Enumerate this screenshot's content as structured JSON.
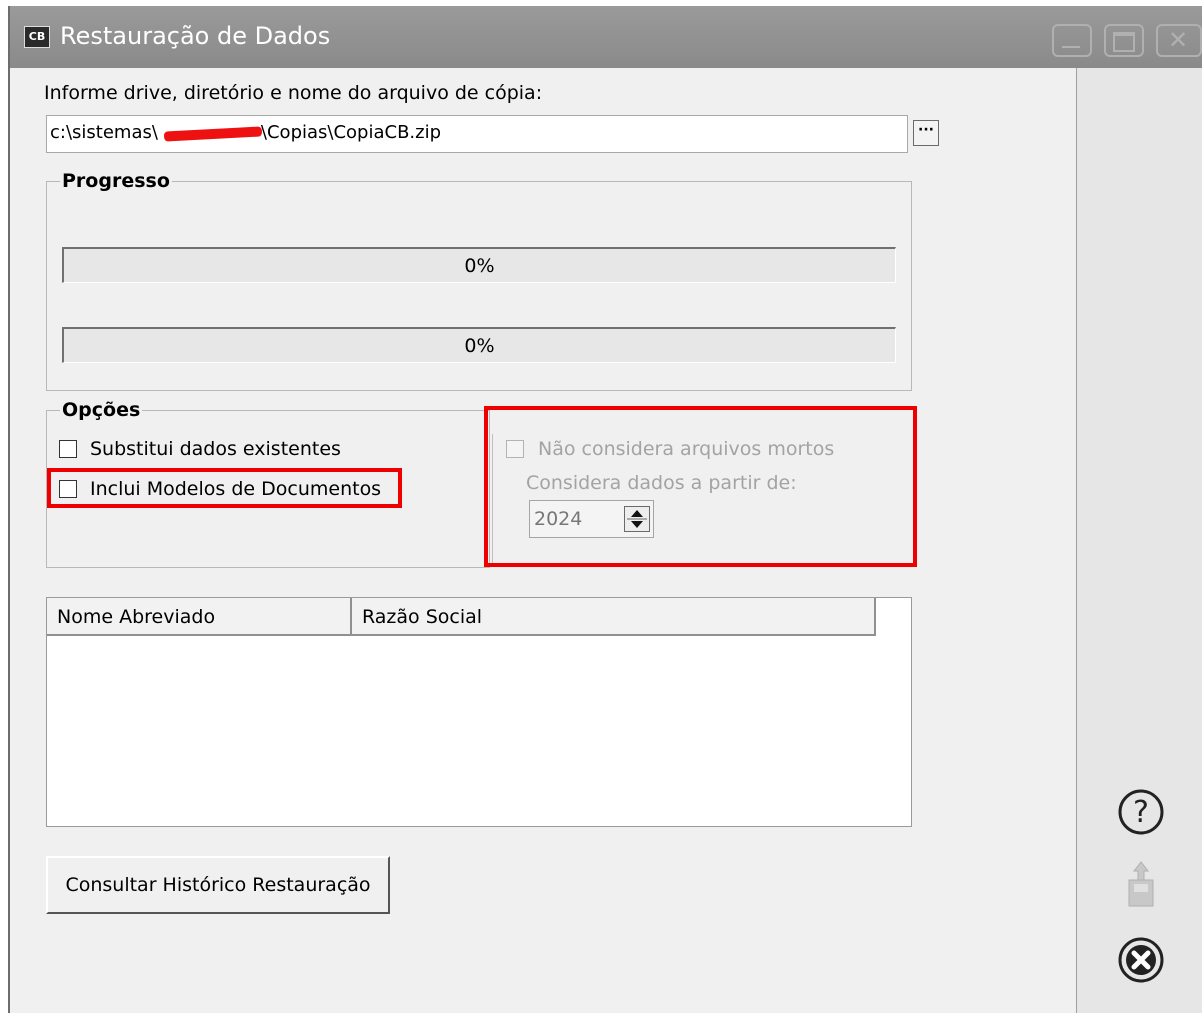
{
  "window": {
    "app_icon": "CB",
    "title": "Restauração de Dados",
    "caption_buttons": [
      "minimize-icon",
      "maximize-icon",
      "close-icon"
    ]
  },
  "path_section": {
    "label": "Informe drive, diretório e nome do arquivo de cópia:",
    "value_prefix": "c:\\sistemas\\",
    "value_suffix": "\\Copias\\CopiaCB.zip",
    "browse_label": "···"
  },
  "progress": {
    "title": "Progresso",
    "bars": [
      {
        "percent": 0,
        "label": "0%"
      },
      {
        "percent": 0,
        "label": "0%"
      }
    ]
  },
  "options": {
    "title": "Opções",
    "substitui_label": "Substitui dados existentes",
    "substitui_checked": false,
    "modelos_label": "Inclui Modelos de Documentos",
    "modelos_checked": false,
    "arquivos_mortos_label": "Não considera arquivos mortos",
    "arquivos_mortos_checked": false,
    "arquivos_mortos_enabled": false,
    "considera_label": "Considera dados a partir de:",
    "year_value": "2024"
  },
  "table": {
    "columns": [
      "Nome Abreviado",
      "Razão Social"
    ],
    "rows": []
  },
  "buttons": {
    "historico_label": "Consultar Histórico Restauração"
  },
  "side_icons": [
    "help-icon",
    "upload-icon",
    "close-circle-icon"
  ],
  "colors": {
    "highlight": "#ee0000",
    "titlebar": "#8f8f8f",
    "window_bg": "#f0f0f0"
  }
}
